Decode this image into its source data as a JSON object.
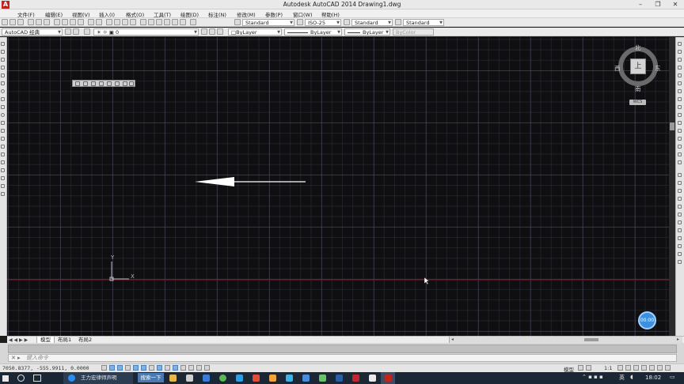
{
  "window": {
    "title": "Autodesk AutoCAD 2014    Drawing1.dwg",
    "app_icon": "autocad-a-icon"
  },
  "menu": [
    "文件(F)",
    "编辑(E)",
    "视图(V)",
    "插入(I)",
    "格式(O)",
    "工具(T)",
    "绘图(D)",
    "标注(N)",
    "修改(M)",
    "参数(P)",
    "窗口(W)",
    "帮助(H)"
  ],
  "toolbar": {
    "text_style": "Standard",
    "dim_style": "ISO-25",
    "table_style": "Standard",
    "multileader_style": "Standard",
    "workspace": "AutoCAD 经典",
    "layer": "0",
    "color": "ByLayer",
    "linetype": "ByLayer",
    "lineweight": "ByLayer",
    "plotstyle": "ByColor"
  },
  "viewcube": {
    "north": "北",
    "south": "南",
    "east": "东",
    "west": "西",
    "top": "上",
    "wcs": "WCS"
  },
  "ucs": {
    "x": "X",
    "y": "Y"
  },
  "nav_ball_label": "00:00",
  "tabs": [
    "模型",
    "布局1",
    "布局2"
  ],
  "tab_nav": "◀ ◀ ▶ ▶",
  "command": {
    "placeholder": "键入命令"
  },
  "status": {
    "coordinates": "7050.8377, -555.9911, 0.0000",
    "model": "模型",
    "scale": "1:1"
  },
  "taskbar": {
    "app_label": "王力宏律师声明",
    "search_label": "搜索一下",
    "ime": "英",
    "time": "18:02"
  },
  "colors": {
    "canvas": "#0f0f12",
    "grid_major": "#50506a",
    "arrow": "#ffffff",
    "nav_ball": "#3d8fe0",
    "taskbar": "#1b2735"
  }
}
